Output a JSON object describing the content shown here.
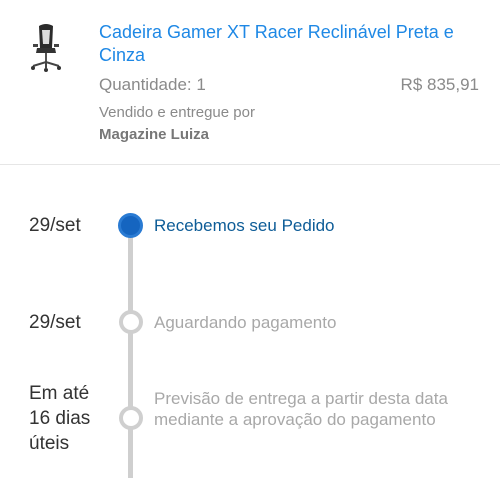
{
  "product": {
    "title": "Cadeira Gamer XT Racer Reclinável Preta e Cinza",
    "thumbnail_icon": "gamer-chair-icon",
    "quantity": "Quantidade: 1",
    "price": "R$ 835,91",
    "sold_by_label": "Vendido e entregue por",
    "seller": "Magazine Luiza"
  },
  "timeline": {
    "steps": [
      {
        "date": "29/set",
        "label": "Recebemos seu Pedido",
        "status": "done"
      },
      {
        "date": "29/set",
        "label": "Aguardando pagamento",
        "status": "pending"
      },
      {
        "date": "Em até 16 dias úteis",
        "label": "Previsão de entrega a partir desta data mediante a aprovação do pagamento",
        "status": "pending"
      }
    ]
  },
  "colors": {
    "accent": "#1e88e5",
    "active_dot": "#1565c0",
    "active_label": "#0d5c97",
    "muted": "#a8a8a8",
    "track": "#cfcfcf"
  }
}
